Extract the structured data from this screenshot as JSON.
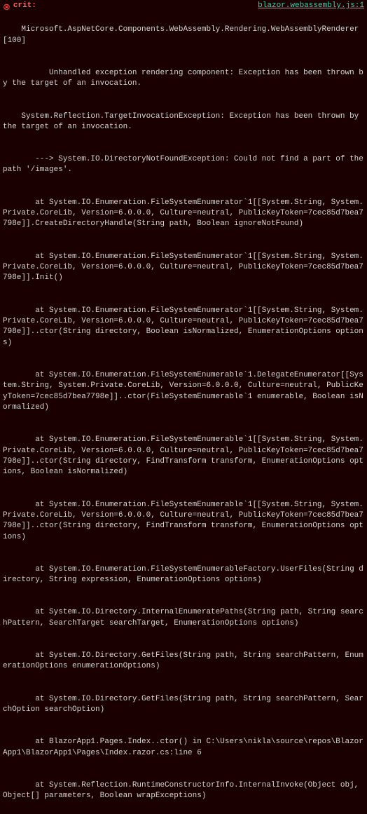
{
  "header": {
    "icon": "●",
    "label": "crit:",
    "file_link": "blazor.webassembly.js:1"
  },
  "lines": [
    "Microsoft.AspNetCore.Components.WebAssembly.Rendering.WebAssemblyRenderer[100]",
    "      Unhandled exception rendering component: Exception has been thrown by the target of an invocation.",
    "System.Reflection.TargetInvocationException: Exception has been thrown by the target of an invocation.",
    "   ---> System.IO.DirectoryNotFoundException: Could not find a part of the path '/images'.",
    "   at System.IO.Enumeration.FileSystemEnumerator`1[[System.String, System.Private.CoreLib, Version=6.0.0.0, Culture=neutral, PublicKeyToken=7cec85d7bea7798e]].CreateDirectoryHandle(String path, Boolean ignoreNotFound)",
    "   at System.IO.Enumeration.FileSystemEnumerator`1[[System.String, System.Private.CoreLib, Version=6.0.0.0, Culture=neutral, PublicKeyToken=7cec85d7bea7798e]].Init()",
    "   at System.IO.Enumeration.FileSystemEnumerator`1[[System.String, System.Private.CoreLib, Version=6.0.0.0, Culture=neutral, PublicKeyToken=7cec85d7bea7798e]]..ctor(String directory, Boolean isNormalized, EnumerationOptions options)",
    "   at System.IO.Enumeration.FileSystemEnumerable`1.DelegateEnumerator[[System.String, System.Private.CoreLib, Version=6.0.0.0, Culture=neutral, PublicKeyToken=7cec85d7bea7798e]]..ctor(FileSystemEnumerable`1 enumerable, Boolean isNormalized)",
    "   at System.IO.Enumeration.FileSystemEnumerable`1[[System.String, System.Private.CoreLib, Version=6.0.0.0, Culture=neutral, PublicKeyToken=7cec85d7bea7798e]]..ctor(String directory, FindTransform transform, EnumerationOptions options, Boolean isNormalized)",
    "   at System.IO.Enumeration.FileSystemEnumerable`1[[System.String, System.Private.CoreLib, Version=6.0.0.0, Culture=neutral, PublicKeyToken=7cec85d7bea7798e]]..ctor(String directory, FindTransform transform, EnumerationOptions options)",
    "   at System.IO.Enumeration.FileSystemEnumerableFactory.UserFiles(String directory, String expression, EnumerationOptions options)",
    "   at System.IO.Directory.InternalEnumeratePaths(String path, String searchPattern, SearchTarget searchTarget, EnumerationOptions options)",
    "   at System.IO.Directory.GetFiles(String path, String searchPattern, EnumerationOptions enumerationOptions)",
    "   at System.IO.Directory.GetFiles(String path, String searchPattern, SearchOption searchOption)",
    "   at BlazorApp1.Pages.Index..ctor() in C:\\Users\\nikla\\source\\repos\\BlazorApp1\\BlazorApp1\\Pages\\Index.razor.cs:line 6",
    "   at System.Reflection.RuntimeConstructorInfo.InternalInvoke(Object obj, Object[] parameters, Boolean wrapExceptions)"
  ]
}
